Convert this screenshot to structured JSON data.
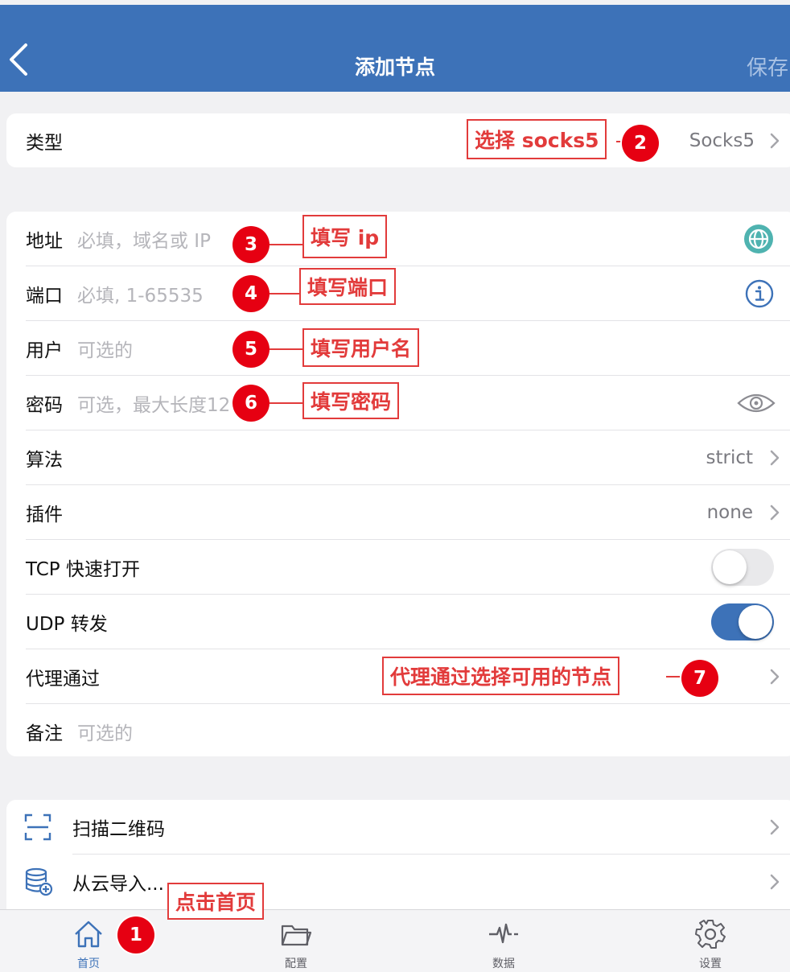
{
  "nav": {
    "title": "添加节点",
    "save_label": "保存"
  },
  "type_row": {
    "label": "类型",
    "value": "Socks5"
  },
  "form": {
    "address": {
      "label": "地址",
      "placeholder": "必填，域名或 IP"
    },
    "port": {
      "label": "端口",
      "placeholder": "必填, 1-65535"
    },
    "user": {
      "label": "用户",
      "placeholder": "可选的"
    },
    "password": {
      "label": "密码",
      "placeholder": "可选，最大长度12"
    },
    "algorithm": {
      "label": "算法",
      "value": "strict"
    },
    "plugin": {
      "label": "插件",
      "value": "none"
    },
    "tcp_fast_open": {
      "label": "TCP 快速打开",
      "on": false
    },
    "udp_forward": {
      "label": "UDP 转发",
      "on": true
    },
    "proxy_via": {
      "label": "代理通过"
    },
    "note": {
      "label": "备注",
      "placeholder": "可选的"
    }
  },
  "actions": {
    "scan_qr": {
      "label": "扫描二维码",
      "icon": "qr-scan-icon"
    },
    "cloud_import": {
      "label": "从云导入...",
      "icon": "database-add-icon"
    }
  },
  "tabbar": {
    "home": {
      "label": "首页",
      "icon": "home-icon"
    },
    "config": {
      "label": "配置",
      "icon": "folder-icon"
    },
    "data": {
      "label": "数据",
      "icon": "pulse-icon"
    },
    "settings": {
      "label": "设置",
      "icon": "gear-icon"
    }
  },
  "annotations": {
    "1": {
      "num": "1",
      "text": "点击首页"
    },
    "2": {
      "num": "2",
      "text": "选择 socks5"
    },
    "3": {
      "num": "3",
      "text": "填写 ip"
    },
    "4": {
      "num": "4",
      "text": "填写端口"
    },
    "5": {
      "num": "5",
      "text": "填写用户名"
    },
    "6": {
      "num": "6",
      "text": "填写密码"
    },
    "7": {
      "num": "7",
      "text": "代理通过选择可用的节点"
    }
  },
  "colors": {
    "nav_bg": "#3d72b8",
    "accent": "#3d72b8",
    "annotation_red": "#e23b3b",
    "badge_red": "#e60012",
    "globe_teal": "#4fb3b0"
  }
}
